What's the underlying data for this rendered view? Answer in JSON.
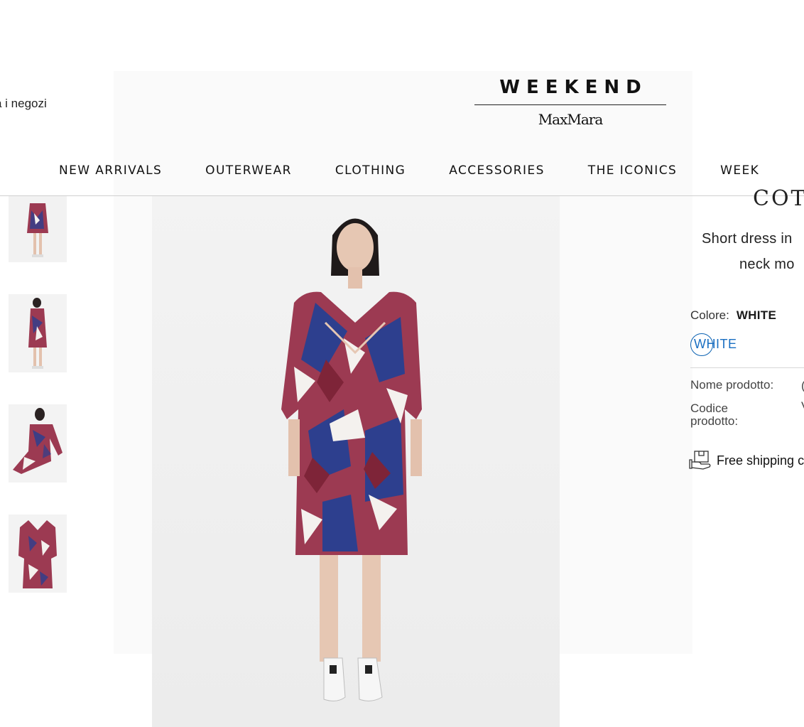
{
  "header": {
    "store_link": "a i negozi",
    "logo_primary": "WEEKEND",
    "logo_secondary": "MaxMara"
  },
  "nav": {
    "items": [
      "NEW ARRIVALS",
      "OUTERWEAR",
      "CLOTHING",
      "ACCESSORIES",
      "THE ICONICS",
      "WEEK"
    ]
  },
  "gallery": {
    "thumbnail_count": 4
  },
  "product": {
    "name_partial": "COT",
    "description_lines": [
      "Short dress in",
      "neck mo"
    ],
    "color_label": "Colore:",
    "color_value": "WHITE",
    "swatch_label": "WHITE",
    "specs": [
      {
        "label": "Nome prodotto:",
        "value": "("
      },
      {
        "label": "Codice prodotto:",
        "value": "V"
      }
    ],
    "shipping_text": "Free shipping c"
  },
  "colors": {
    "dress_red": "#9c3a52",
    "dress_blue": "#2d3f8e",
    "dress_white": "#f4f1ee",
    "swatch_blue": "#0b62b2"
  }
}
